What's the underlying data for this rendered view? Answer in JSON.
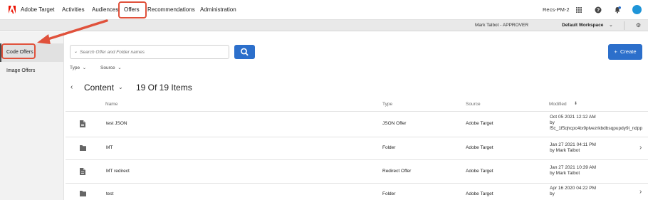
{
  "topnav": {
    "brand": "Adobe Target",
    "items": [
      {
        "label": "Activities"
      },
      {
        "label": "Audiences"
      },
      {
        "label": "Offers"
      },
      {
        "label": "Recommendations"
      },
      {
        "label": "Administration"
      }
    ],
    "account": "Recs-PM-2",
    "icons": [
      "apps-grid-icon",
      "help-icon",
      "notifications-bell-icon",
      "user-avatar"
    ]
  },
  "subbar": {
    "role": "Mark Talbot - APPROVER",
    "workspace": "Default Workspace"
  },
  "sidebar": {
    "items": [
      {
        "label": "Code Offers"
      },
      {
        "label": "Image Offers"
      }
    ]
  },
  "search": {
    "placeholder": "Search Offer and Folder names"
  },
  "create_label": "Create",
  "filters": [
    {
      "label": "Type"
    },
    {
      "label": "Source"
    }
  ],
  "content": {
    "title": "Content",
    "count": "19 Of 19 Items"
  },
  "table": {
    "columns": [
      "Name",
      "Type",
      "Source",
      "Modified"
    ],
    "rows": [
      {
        "name": "test JSON",
        "type": "JSON Offer",
        "source": "Adobe Target",
        "modified_1": "Oct 05 2021 12:12 AM",
        "modified_2": "by",
        "modified_3": "f5c_1f5qhcpc4tx9plvezrkbdbsqpupdy9i_ndpp",
        "icon": "code-offer-icon"
      },
      {
        "name": "MT",
        "type": "Folder",
        "source": "Adobe Target",
        "modified_1": "Jan 27 2021  04:11 PM",
        "modified_2": "by Mark Talbot",
        "modified_3": "",
        "icon": "folder-icon"
      },
      {
        "name": "MT redirect",
        "type": "Redirect Offer",
        "source": "Adobe Target",
        "modified_1": "Jan 27 2021 10:39 AM",
        "modified_2": "by Mark Talbot",
        "modified_3": "",
        "icon": "code-offer-icon"
      },
      {
        "name": "test",
        "type": "Folder",
        "source": "Adobe Target",
        "modified_1": "Apr 16 2020  04:22 PM",
        "modified_2": "by",
        "modified_3": "",
        "icon": "folder-icon"
      }
    ]
  },
  "colors": {
    "accent": "#2c6fcb",
    "highlight": "#e0513b",
    "adobe_red": "#eb1000"
  }
}
